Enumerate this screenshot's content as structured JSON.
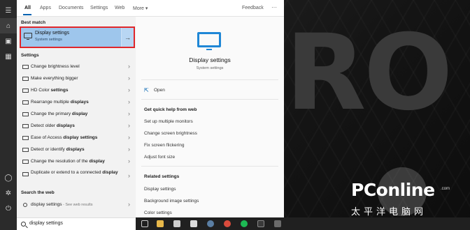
{
  "tabs": [
    {
      "label": "All",
      "active": true
    },
    {
      "label": "Apps"
    },
    {
      "label": "Documents"
    },
    {
      "label": "Settings"
    },
    {
      "label": "Web"
    },
    {
      "label": "More ▾"
    }
  ],
  "feedback_label": "Feedback",
  "more_dots": "···",
  "best_match": {
    "heading": "Best match",
    "title": "Display settings",
    "subtitle": "System settings",
    "arrow": "→"
  },
  "settings_heading": "Settings",
  "settings_items": [
    {
      "pre": "Change brightness level",
      "bold": ""
    },
    {
      "pre": "Make everything bigger",
      "bold": ""
    },
    {
      "pre": "HD Color ",
      "bold": "settings"
    },
    {
      "pre": "Rearrange multiple ",
      "bold": "displays"
    },
    {
      "pre": "Change the primary ",
      "bold": "display"
    },
    {
      "pre": "Detect older ",
      "bold": "displays"
    },
    {
      "pre": "Ease of Access ",
      "bold": "display settings"
    },
    {
      "pre": "Detect or identify ",
      "bold": "displays"
    },
    {
      "pre": "Change the resolution of the ",
      "bold": "display"
    },
    {
      "pre": "Duplicate or extend to a connected ",
      "bold": "display"
    }
  ],
  "web_heading": "Search the web",
  "web_item": {
    "query": "display settings",
    "suffix": " - See web results"
  },
  "preview": {
    "title": "Display settings",
    "subtitle": "System settings",
    "open_label": "Open",
    "help_heading": "Get quick help from web",
    "help_items": [
      "Set up multiple monitors",
      "Change screen brightness",
      "Fix screen flickering",
      "Adjust font size"
    ],
    "related_heading": "Related settings",
    "related_items": [
      "Display settings",
      "Background image settings",
      "Color settings"
    ]
  },
  "search_box": {
    "value": "display settings"
  },
  "watermark": {
    "brand": "PConline",
    "dotcom": ".com",
    "cn": "太平洋电脑网"
  },
  "desktop_letters": [
    "R",
    "O"
  ],
  "colors": {
    "accent": "#0063b1",
    "highlight": "#9ec6ec",
    "selection_border": "#e0262a"
  }
}
